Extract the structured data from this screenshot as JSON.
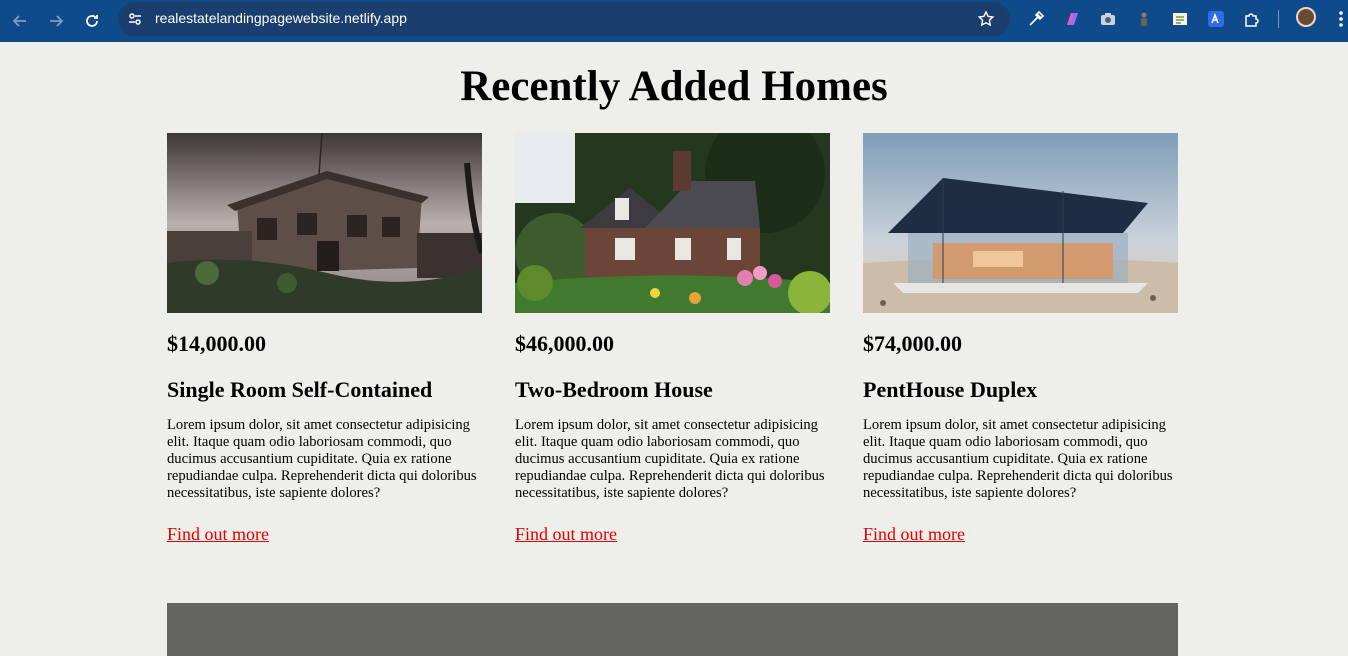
{
  "browser": {
    "url": "realestatelandingpagewebsite.netlify.app"
  },
  "page": {
    "title": "Recently Added Homes"
  },
  "listings": [
    {
      "price": "$14,000.00",
      "name": "Single Room Self-Contained",
      "description": "Lorem ipsum dolor, sit amet consectetur adipisicing elit. Itaque quam odio laboriosam commodi, quo ducimus accusantium cupiditate. Quia ex ratione repudiandae culpa. Reprehenderit dicta qui doloribus necessitatibus, iste sapiente dolores?",
      "link": "Find out more"
    },
    {
      "price": "$46,000.00",
      "name": "Two-Bedroom House",
      "description": "Lorem ipsum dolor, sit amet consectetur adipisicing elit. Itaque quam odio laboriosam commodi, quo ducimus accusantium cupiditate. Quia ex ratione repudiandae culpa. Reprehenderit dicta qui doloribus necessitatibus, iste sapiente dolores?",
      "link": "Find out more"
    },
    {
      "price": "$74,000.00",
      "name": "PentHouse Duplex",
      "description": "Lorem ipsum dolor, sit amet consectetur adipisicing elit. Itaque quam odio laboriosam commodi, quo ducimus accusantium cupiditate. Quia ex ratione repudiandae culpa. Reprehenderit dicta qui doloribus necessitatibus, iste sapiente dolores?",
      "link": "Find out more"
    }
  ],
  "colors": {
    "chrome_bg": "#0f4a8a",
    "page_bg": "#eeeeea",
    "link": "#e00000",
    "footer_band": "#646462"
  }
}
